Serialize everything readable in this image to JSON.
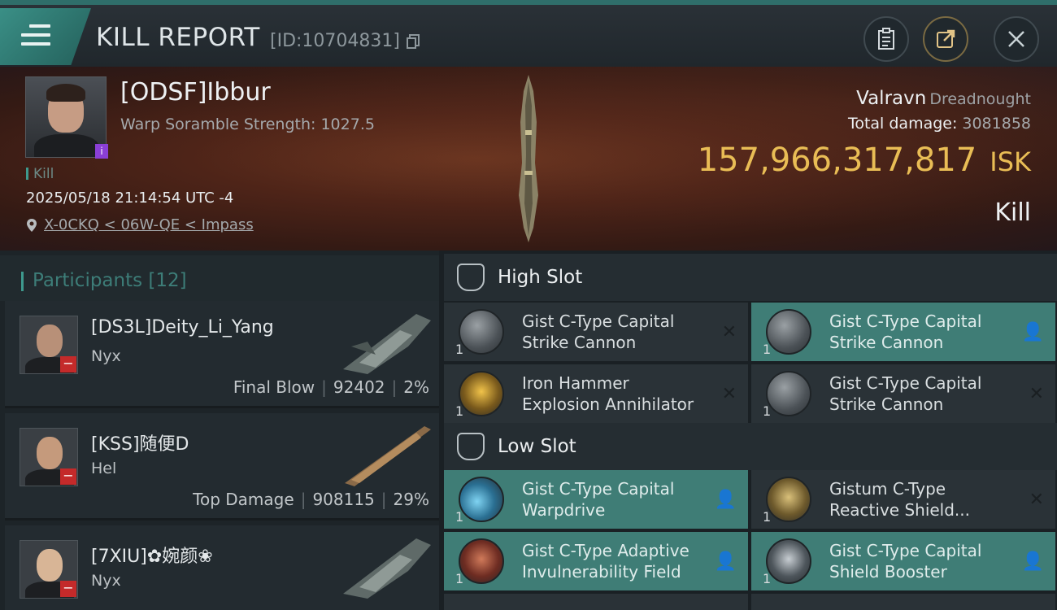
{
  "header": {
    "title": "KILL REPORT",
    "report_id": "[ID:10704831]"
  },
  "victim": {
    "name": "[ODSF]Ibbur",
    "scramble": "Warp Soramble Strength: 1027.5",
    "status_tag": "Kill",
    "datetime": "2025/05/18 21:14:54 UTC -4",
    "location": "X-0CKQ < 06W-QE < Impass",
    "ship_name": "Valravn",
    "ship_class": "Dreadnought",
    "total_damage_label": "Total damage:",
    "total_damage": "3081858",
    "isk_value": "157,966,317,817",
    "isk_unit": "ISK",
    "result": "Kill"
  },
  "participants": {
    "label": "Participants",
    "count": "[12]",
    "rows": [
      {
        "name": "[DS3L]Deity_Li_Yang",
        "ship": "Nyx",
        "role": "Final Blow",
        "damage": "92402",
        "percent": "2%"
      },
      {
        "name": "[KSS]随便D",
        "ship": "Hel",
        "role": "Top Damage",
        "damage": "908115",
        "percent": "29%"
      },
      {
        "name": "[7XIU]✿婉颜❀",
        "ship": "Nyx"
      }
    ]
  },
  "fitting": {
    "high_slot_label": "High Slot",
    "low_slot_label": "Low Slot",
    "high": [
      {
        "line1": "Gist C-Type Capital",
        "line2": "Strike Cannon",
        "qty": "1",
        "state": "destroyed"
      },
      {
        "line1": "Gist C-Type Capital",
        "line2": "Strike Cannon",
        "qty": "1",
        "state": "dropped"
      },
      {
        "line1": "Iron Hammer",
        "line2": "Explosion Annihilator",
        "qty": "1",
        "state": "destroyed"
      },
      {
        "line1": "Gist C-Type Capital",
        "line2": "Strike Cannon",
        "qty": "1",
        "state": "destroyed"
      }
    ],
    "low": [
      {
        "line1": "Gist C-Type Capital",
        "line2": "Warpdrive",
        "qty": "1",
        "state": "dropped"
      },
      {
        "line1": "Gistum C-Type",
        "line2": "Reactive Shield...",
        "qty": "1",
        "state": "destroyed"
      },
      {
        "line1": "Gist C-Type Adaptive",
        "line2": "Invulnerability Field",
        "qty": "1",
        "state": "dropped"
      },
      {
        "line1": "Gist C-Type Capital",
        "line2": "Shield Booster",
        "qty": "1",
        "state": "dropped"
      }
    ]
  },
  "colors": {
    "accent": "#3e9a8e",
    "isk": "#e9bd55",
    "dropped_bg": "#3f7d76",
    "destroyed_bg": "#2a3237",
    "badge_red": "#c42a2a"
  }
}
